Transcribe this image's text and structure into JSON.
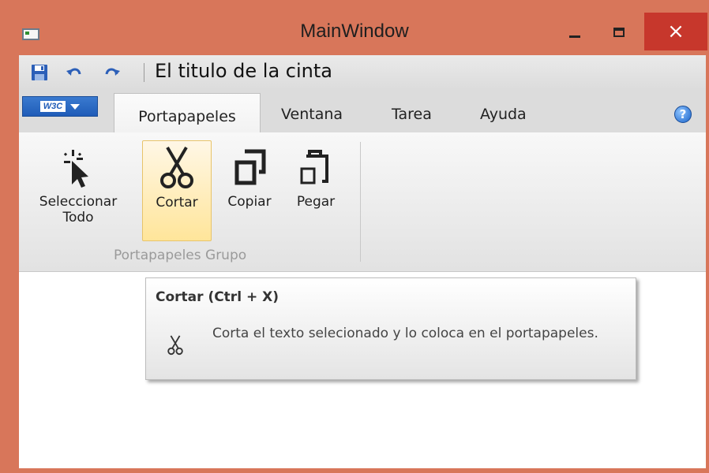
{
  "window": {
    "title": "MainWindow",
    "close_glyph": "×",
    "accent_color": "#d8765a",
    "close_color": "#c7372c"
  },
  "qat": {
    "icons": [
      "save-icon",
      "undo-icon",
      "redo-icon"
    ],
    "ribbon_title": "El titulo de la cinta"
  },
  "app_menu": {
    "logo_text": "W3C"
  },
  "tabs": [
    {
      "label": "Portapapeles",
      "active": true
    },
    {
      "label": "Ventana",
      "active": false
    },
    {
      "label": "Tarea",
      "active": false
    },
    {
      "label": "Ayuda",
      "active": false
    }
  ],
  "help": {
    "glyph": "?"
  },
  "ribbon_group": {
    "label": "Portapapeles Grupo",
    "buttons": [
      {
        "label": "Seleccionar Todo",
        "icon": "select-all-cursor-icon",
        "highlighted": false
      },
      {
        "label": "Cortar",
        "icon": "scissors-icon",
        "highlighted": true
      },
      {
        "label": "Copiar",
        "icon": "copy-icon",
        "highlighted": false
      },
      {
        "label": "Pegar",
        "icon": "paste-icon",
        "highlighted": false
      }
    ]
  },
  "tooltip": {
    "title": "Cortar (Ctrl + X)",
    "description": "Corta el texto selecionado y lo coloca en el portapapeles.",
    "icon": "scissors-icon"
  }
}
